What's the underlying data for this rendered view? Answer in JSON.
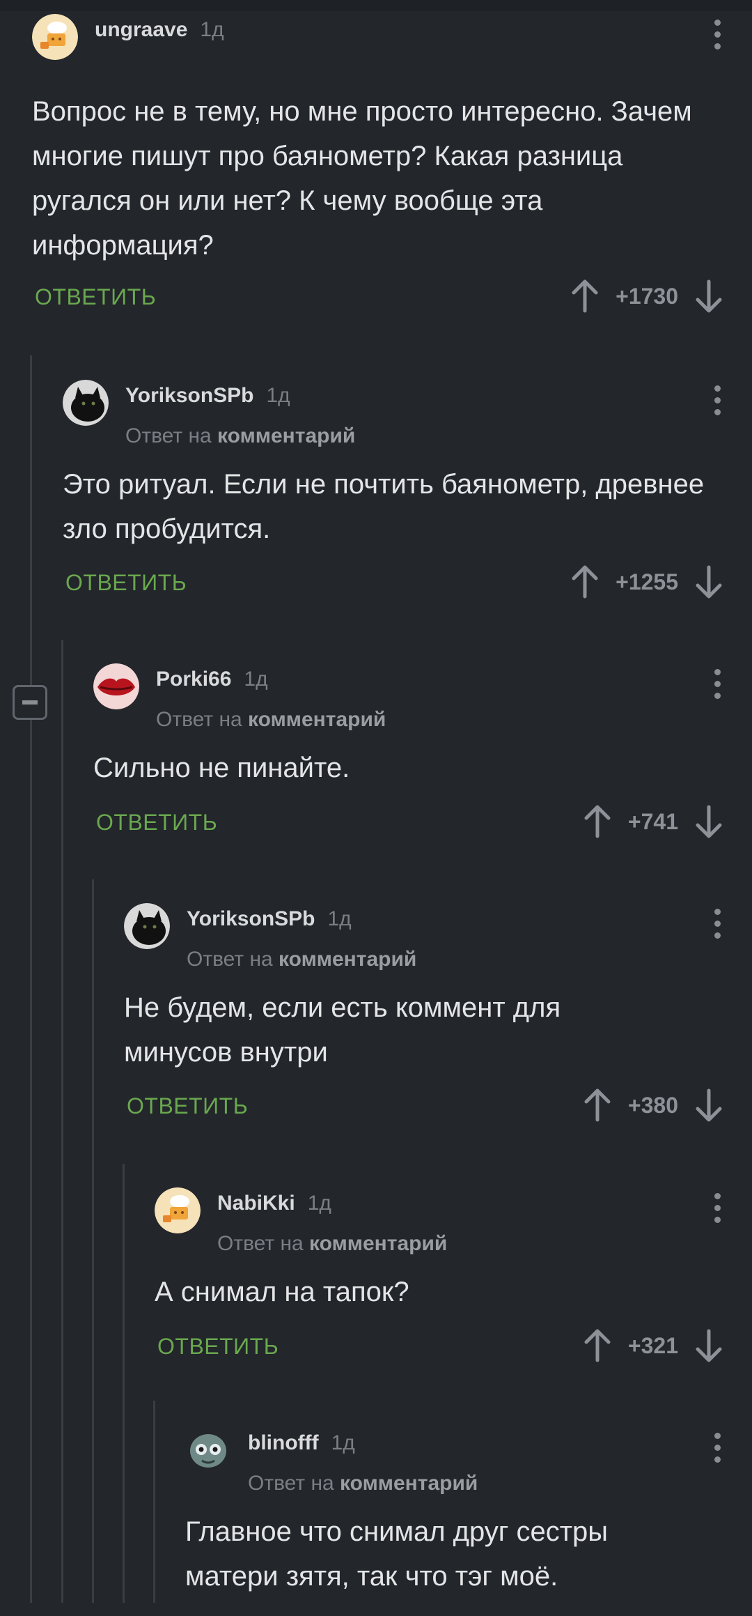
{
  "reply_to_prefix": "Ответ на",
  "reply_to_target": "комментарий",
  "reply_label": "ОТВЕТИТЬ",
  "accent_color": "#6aa84f",
  "comments": [
    {
      "username": "ungraave",
      "time": "1д",
      "avatar_icon": "chef-avatar",
      "is_reply": false,
      "text": "Вопрос не в тему, но мне просто интересно. Зачем многие пишут про баянометр? Какая разница ругался он или нет? К чему вообще эта информация?",
      "rating": "+1730"
    },
    {
      "username": "YoriksonSPb",
      "time": "1д",
      "avatar_icon": "black-cat-avatar",
      "is_reply": true,
      "text": "Это ритуал. Если не почтить баянометр, древнее зло пробудится.",
      "rating": "+1255"
    },
    {
      "username": "Porki66",
      "time": "1д",
      "avatar_icon": "red-lips-avatar",
      "is_reply": true,
      "text": "Сильно не пинайте.",
      "rating": "+741"
    },
    {
      "username": "YoriksonSPb",
      "time": "1д",
      "avatar_icon": "black-cat-avatar",
      "is_reply": true,
      "text": "Не будем, если есть коммент для минусов внутри",
      "rating": "+380"
    },
    {
      "username": "NabiKki",
      "time": "1д",
      "avatar_icon": "chef-avatar",
      "is_reply": true,
      "text": "А снимал на тапок?",
      "rating": "+321"
    },
    {
      "username": "blinofff",
      "time": "1д",
      "avatar_icon": "creature-avatar",
      "is_reply": true,
      "text": "Главное что снимал друг сестры матери зятя, так что тэг моё.",
      "rating": ""
    }
  ]
}
